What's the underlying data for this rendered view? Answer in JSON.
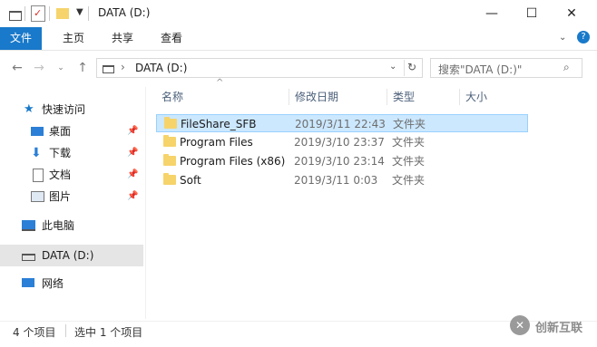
{
  "window": {
    "title": "DATA (D:)",
    "buttons": {
      "minimize": "—",
      "maximize": "☐",
      "close": "✕"
    }
  },
  "ribbon": {
    "tabs": [
      {
        "label": "文件"
      },
      {
        "label": "主页"
      },
      {
        "label": "共享"
      },
      {
        "label": "查看"
      }
    ]
  },
  "address": {
    "path": "DATA (D:)",
    "search_placeholder": "搜索\"DATA (D:)\""
  },
  "navigation": {
    "quick_access": "快速访问",
    "items": [
      {
        "label": "桌面",
        "icon": "desktop-icon",
        "pinned": true
      },
      {
        "label": "下载",
        "icon": "download-icon",
        "pinned": true
      },
      {
        "label": "文档",
        "icon": "document-icon",
        "pinned": true
      },
      {
        "label": "图片",
        "icon": "picture-icon",
        "pinned": true
      }
    ],
    "this_pc": "此电脑",
    "drive": "DATA (D:)",
    "network": "网络"
  },
  "columns": {
    "name": "名称",
    "modified": "修改日期",
    "type": "类型",
    "size": "大小"
  },
  "files": [
    {
      "name": "FileShare_SFB",
      "modified": "2019/3/11 22:43",
      "type": "文件夹",
      "selected": true
    },
    {
      "name": "Program Files",
      "modified": "2019/3/10 23:37",
      "type": "文件夹",
      "selected": false
    },
    {
      "name": "Program Files (x86)",
      "modified": "2019/3/10 23:14",
      "type": "文件夹",
      "selected": false
    },
    {
      "name": "Soft",
      "modified": "2019/3/11 0:03",
      "type": "文件夹",
      "selected": false
    }
  ],
  "status": {
    "count": "4 个项目",
    "selection": "选中 1 个项目"
  },
  "watermark": {
    "text": "创新互联"
  },
  "colors": {
    "accent": "#1979ca",
    "selected_row": "#cce8ff",
    "folder": "#f6d46b",
    "header_text": "#4c607a"
  }
}
